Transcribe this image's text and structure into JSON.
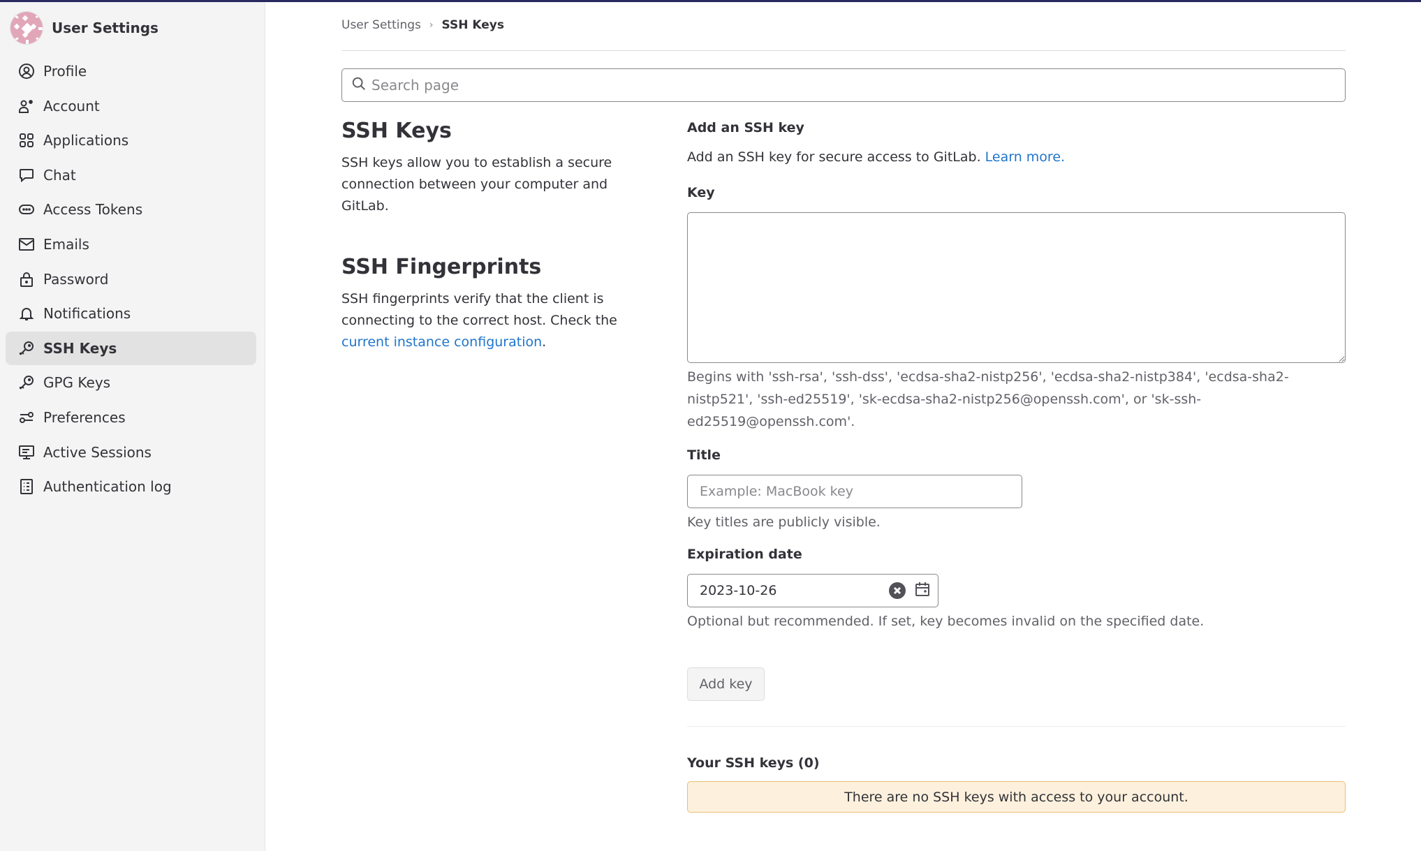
{
  "sidebar": {
    "title": "User Settings",
    "avatar_color": "#e2a6b9",
    "items": [
      {
        "label": "Profile",
        "icon": "profile-icon"
      },
      {
        "label": "Account",
        "icon": "account-icon"
      },
      {
        "label": "Applications",
        "icon": "applications-icon"
      },
      {
        "label": "Chat",
        "icon": "chat-icon"
      },
      {
        "label": "Access Tokens",
        "icon": "token-icon"
      },
      {
        "label": "Emails",
        "icon": "mail-icon"
      },
      {
        "label": "Password",
        "icon": "lock-icon"
      },
      {
        "label": "Notifications",
        "icon": "bell-icon"
      },
      {
        "label": "SSH Keys",
        "icon": "key-icon",
        "active": true
      },
      {
        "label": "GPG Keys",
        "icon": "key-icon"
      },
      {
        "label": "Preferences",
        "icon": "preferences-icon"
      },
      {
        "label": "Active Sessions",
        "icon": "monitor-icon"
      },
      {
        "label": "Authentication log",
        "icon": "log-icon"
      }
    ]
  },
  "breadcrumb": {
    "parent": "User Settings",
    "separator": "›",
    "current": "SSH Keys"
  },
  "search": {
    "placeholder": "Search page",
    "value": ""
  },
  "left": {
    "ssh_keys_title": "SSH Keys",
    "ssh_keys_desc": "SSH keys allow you to establish a secure connection between your computer and GitLab.",
    "fingerprints_title": "SSH Fingerprints",
    "fingerprints_desc_before": "SSH fingerprints verify that the client is connecting to the correct host. Check the ",
    "fingerprints_link": "current instance configuration",
    "fingerprints_desc_after": "."
  },
  "form": {
    "heading": "Add an SSH key",
    "description": "Add an SSH key for secure access to GitLab. ",
    "learn_more": "Learn more.",
    "key_label": "Key",
    "key_value": "",
    "key_help": "Begins with 'ssh-rsa', 'ssh-dss', 'ecdsa-sha2-nistp256', 'ecdsa-sha2-nistp384', 'ecdsa-sha2-nistp521', 'ssh-ed25519', 'sk-ecdsa-sha2-nistp256@openssh.com', or 'sk-ssh-ed25519@openssh.com'.",
    "title_label": "Title",
    "title_placeholder": "Example: MacBook key",
    "title_value": "",
    "title_help": "Key titles are publicly visible.",
    "expiration_label": "Expiration date",
    "expiration_value": "2023-10-26",
    "expiration_help": "Optional but recommended. If set, key becomes invalid on the specified date.",
    "submit_label": "Add key"
  },
  "keys_list": {
    "heading": "Your SSH keys (0)",
    "empty_message": "There are no SSH keys with access to your account."
  },
  "colors": {
    "topbar": "#292961",
    "link": "#1f75cb",
    "alert_bg": "#fdf1dd",
    "alert_border": "#e9be74"
  }
}
